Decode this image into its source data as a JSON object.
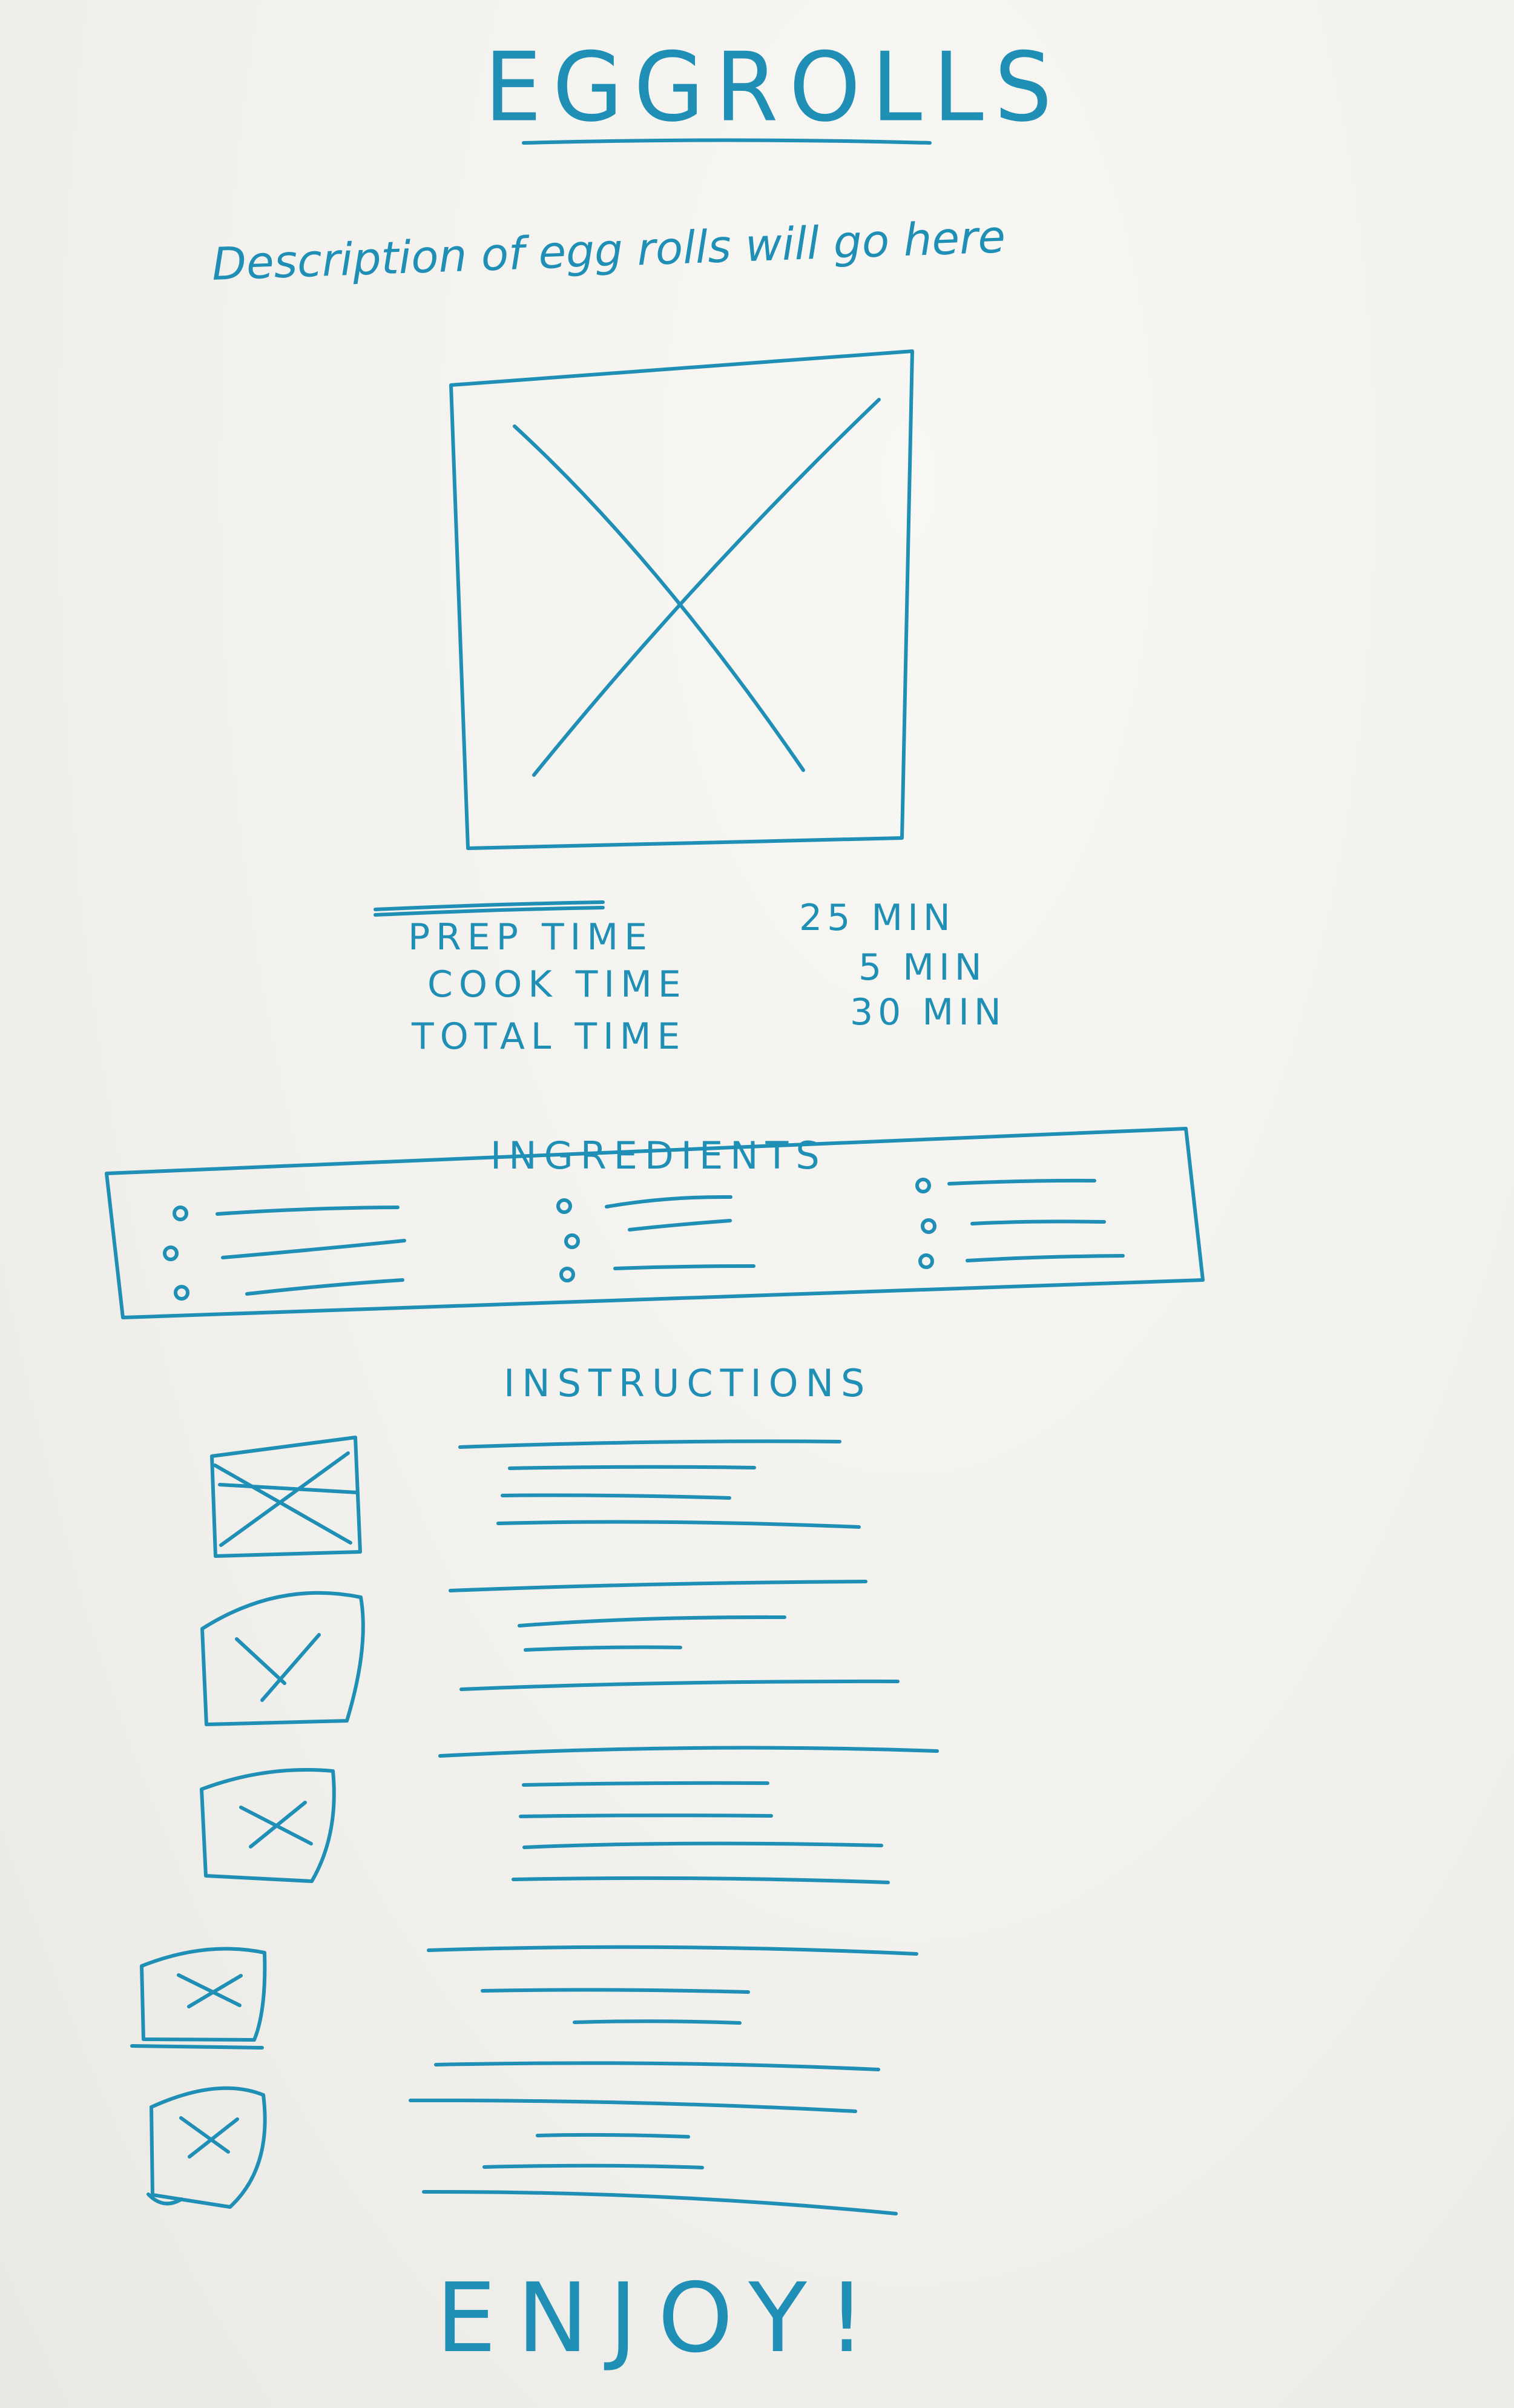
{
  "title": "EGGROLLS",
  "description": "Description of egg rolls will go here",
  "times": [
    {
      "label": "PREP TIME",
      "value": "25 MIN"
    },
    {
      "label": "COOK TIME",
      "value": "5 MIN"
    },
    {
      "label": "TOTAL TIME",
      "value": "30 MIN"
    }
  ],
  "ingredients_title": "INGREDIENTS",
  "instructions_title": "INSTRUCTIONS",
  "closing": "ENJOY!",
  "colors": {
    "ink": "#1f8fb5",
    "paper": "#f4f3ef"
  },
  "icons": {
    "image_placeholder": "image-placeholder-icon"
  }
}
